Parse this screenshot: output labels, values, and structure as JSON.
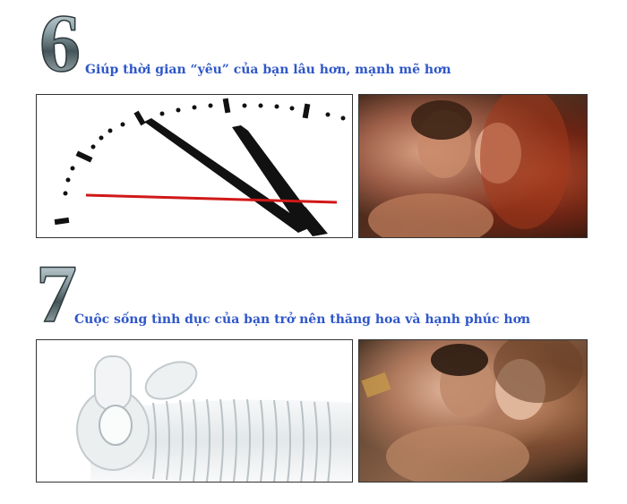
{
  "sections": [
    {
      "number": "6",
      "headline": "Giúp thời gian “yêu” của bạn lâu hơn, mạnh mẽ hơn",
      "left_image": "clock-face",
      "right_image": "kissing-couple"
    },
    {
      "number": "7",
      "headline": "Cuộc sống tình dục của bạn trở nên thăng hoa và hạnh phúc hơn",
      "left_image": "clear-sleeve-device",
      "right_image": "embracing-couple"
    }
  ],
  "colors": {
    "headline": "#2f57c8",
    "number": "#5f7378",
    "clock_second_hand": "#d01818"
  }
}
